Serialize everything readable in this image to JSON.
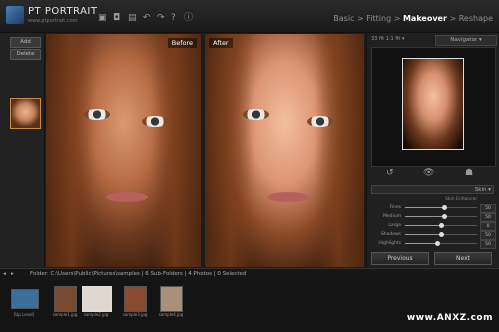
{
  "header": {
    "title": "PT PORTRAIT",
    "subtitle": "www.ptportrait.com",
    "toolbar": [
      "▣",
      "◘",
      "▤",
      "↶",
      "↷",
      "?",
      "ⓘ"
    ],
    "steps": [
      "Basic",
      ">",
      "Fitting",
      ">",
      "Makeover",
      ">",
      "Reshape"
    ],
    "active_step": "Makeover"
  },
  "left_panel": {
    "add_label": "Add",
    "delete_label": "Delete"
  },
  "photos": {
    "before_label": "Before",
    "after_label": "After"
  },
  "right_panel": {
    "top_text": "33 fit 1:1 fit ▾",
    "navigator_label": "Navigator ▾",
    "icons": [
      "↺",
      "👁",
      "☗"
    ],
    "preset_label": "Skin ▾",
    "slider_header": "Skin Enhancer",
    "sliders": [
      {
        "label": "Fines",
        "value": "50",
        "level": 0.55
      },
      {
        "label": "Medium",
        "value": "50",
        "level": 0.55
      },
      {
        "label": "Large",
        "value": "0",
        "level": 0.5
      },
      {
        "label": "Shadows",
        "value": "50",
        "level": 0.5
      },
      {
        "label": "Highlights",
        "value": "50",
        "level": 0.45
      }
    ],
    "previous_label": "Previous",
    "next_label": "Next"
  },
  "folder_bar": {
    "text": "Folder: C:\\Users\\Public\\Pictures\\samples | 6 Sub-Folders | 4 Photos | 0 Selected",
    "icons": [
      "◂",
      "▸"
    ]
  },
  "filmstrip": {
    "items": [
      {
        "label": "[Up Level]",
        "selected": false,
        "color": "#3a6f9e"
      },
      {
        "label": "sample1.jpg",
        "selected": false,
        "color": "#7a4a30"
      },
      {
        "label": "sample2.jpg",
        "selected": true,
        "color": "#e0d8d0"
      },
      {
        "label": "sample3.jpg",
        "selected": false,
        "color": "#8a4a30"
      },
      {
        "label": "sample4.jpg",
        "selected": false,
        "color": "#a8907a"
      }
    ]
  },
  "watermark": "www.ANXZ.com"
}
